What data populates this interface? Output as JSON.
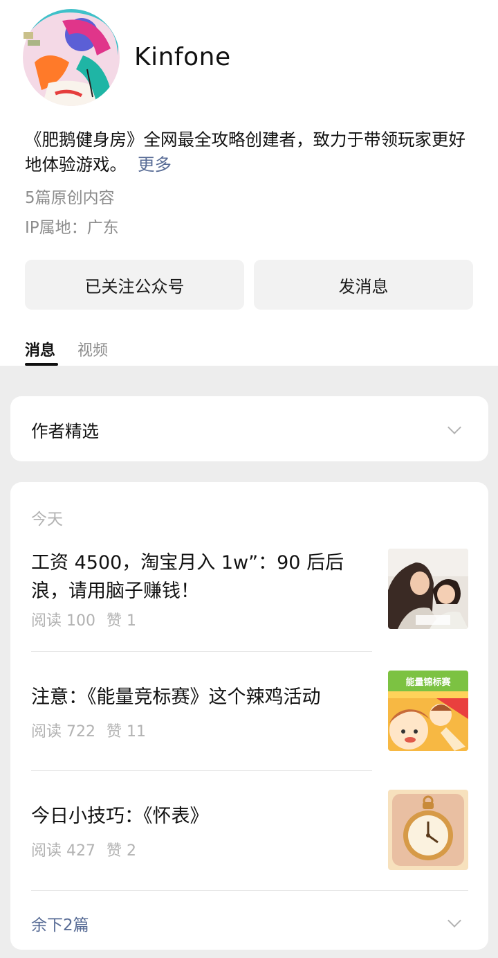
{
  "profile": {
    "name": "Kinfone",
    "bio": "《肥鹅健身房》全网最全攻略创建者，致力于带领玩家更好地体验游戏。",
    "more_label": "更多",
    "original_count": "5篇原创内容",
    "ip_location": "IP属地：广东"
  },
  "actions": {
    "follow_label": "已关注公众号",
    "message_label": "发消息"
  },
  "tabs": [
    {
      "label": "消息",
      "active": true
    },
    {
      "label": "视频",
      "active": false
    }
  ],
  "author_pick": {
    "title": "作者精选",
    "icon": "chevron-down-icon"
  },
  "feed": {
    "date_label": "今天",
    "articles": [
      {
        "title": "工资 4500，淘宝月入 1w”：90 后后浪，请用脑子赚钱！",
        "reads": "阅读 100",
        "likes": "赞 1",
        "thumb": "mother-daughter-photo"
      },
      {
        "title": "注意：《能量竞标赛》这个辣鸡活动",
        "reads": "阅读 722",
        "likes": "赞 11",
        "thumb": "energy-championship-banner",
        "thumb_text": "能量锦标赛"
      },
      {
        "title": "今日小技巧：《怀表》",
        "reads": "阅读 427",
        "likes": "赞 2",
        "thumb": "pocket-watch-icon"
      }
    ],
    "remaining_label": "余下2篇"
  },
  "colors": {
    "link": "#576b95",
    "muted": "#b2b2b2",
    "background": "#ededed"
  }
}
